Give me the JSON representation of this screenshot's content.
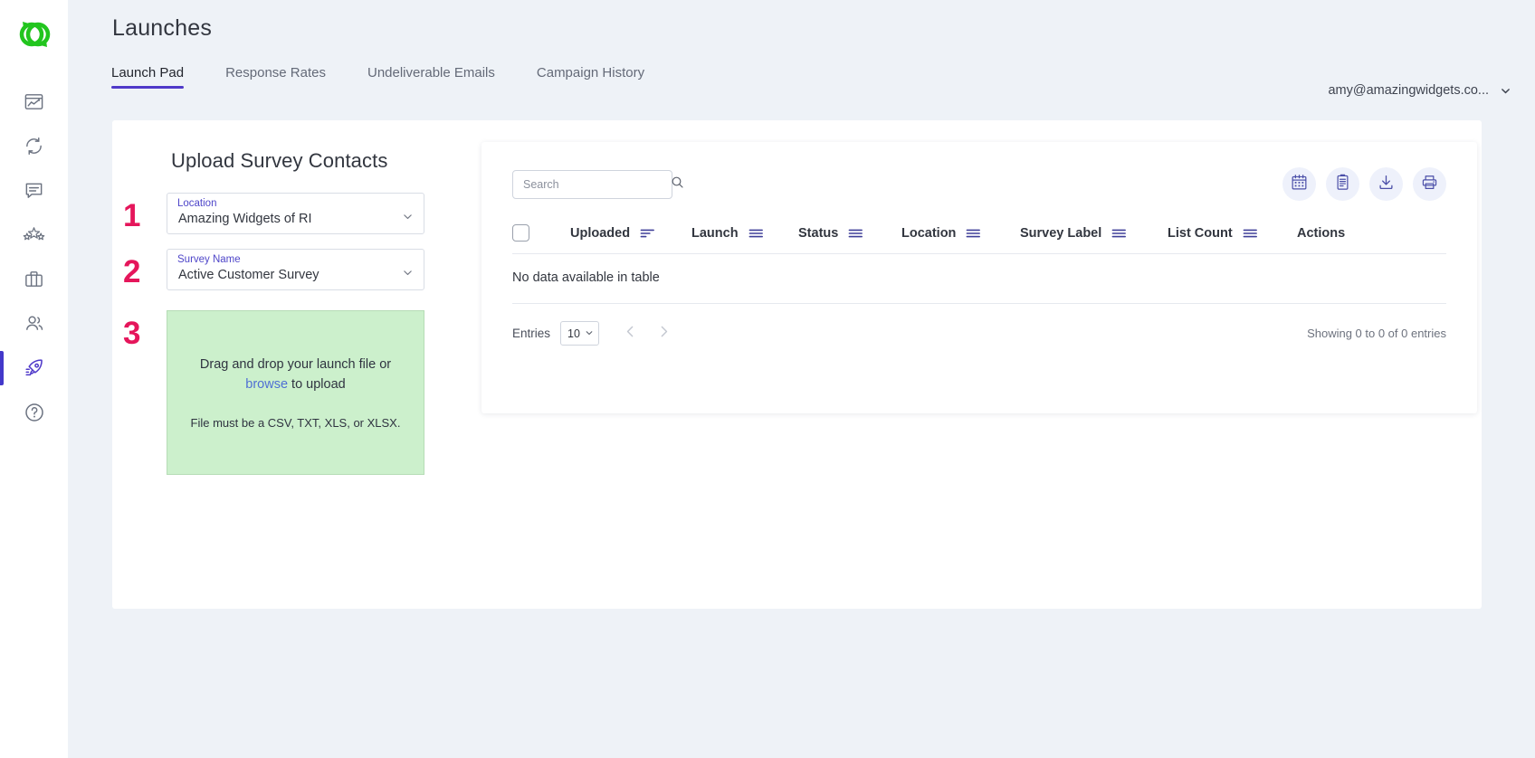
{
  "app": {
    "logo_icon": "green-infinity-links-logo"
  },
  "sidebar": {
    "items": [
      {
        "name": "dashboard-analytics",
        "icon": "dashboard-chart-icon",
        "active": false
      },
      {
        "name": "sync",
        "icon": "refresh-sync-icon",
        "active": false
      },
      {
        "name": "messages",
        "icon": "chat-bubble-icon",
        "active": false
      },
      {
        "name": "reviews",
        "icon": "stars-rating-icon",
        "active": false
      },
      {
        "name": "business",
        "icon": "briefcase-icon",
        "active": false
      },
      {
        "name": "contacts",
        "icon": "people-group-icon",
        "active": false
      },
      {
        "name": "launches",
        "icon": "rocket-icon",
        "active": true
      },
      {
        "name": "help",
        "icon": "question-circle-icon",
        "active": false
      }
    ]
  },
  "header": {
    "title": "Launches",
    "tabs": [
      {
        "label": "Launch Pad",
        "active": true
      },
      {
        "label": "Response Rates",
        "active": false
      },
      {
        "label": "Undeliverable Emails",
        "active": false
      },
      {
        "label": "Campaign History",
        "active": false
      }
    ],
    "user": {
      "email": "amy@amazingwidgets.co...",
      "chevron_icon": "chevron-down-icon"
    }
  },
  "upload": {
    "title": "Upload Survey Contacts",
    "steps": [
      "1",
      "2",
      "3"
    ],
    "location": {
      "label": "Location",
      "value": "Amazing Widgets of RI",
      "chevron_icon": "chevron-down-icon"
    },
    "survey": {
      "label": "Survey Name",
      "value": "Active Customer Survey",
      "chevron_icon": "chevron-down-icon"
    },
    "dropzone": {
      "text_before": "Drag and drop your launch file or",
      "link": "browse",
      "text_after": "to upload",
      "hint": "File must be a CSV, TXT, XLS, or XLSX.",
      "bg_color": "#ccf0cc",
      "link_color": "#4f6fd4"
    }
  },
  "table": {
    "search": {
      "placeholder": "Search",
      "value": "",
      "icon": "search-icon"
    },
    "toolbar": [
      {
        "name": "calendar-button",
        "icon": "calendar-icon"
      },
      {
        "name": "report-button",
        "icon": "clipboard-document-icon"
      },
      {
        "name": "download-button",
        "icon": "download-icon"
      },
      {
        "name": "print-button",
        "icon": "printer-icon"
      }
    ],
    "select_all": {
      "name": "select-all-checkbox",
      "checked": false
    },
    "columns": [
      {
        "label": "Uploaded",
        "sort_icon": "sort-descending-icon",
        "sortable": true
      },
      {
        "label": "Launch",
        "sort_icon": "sort-menu-icon",
        "sortable": true
      },
      {
        "label": "Status",
        "sort_icon": "sort-menu-icon",
        "sortable": true
      },
      {
        "label": "Location",
        "sort_icon": "sort-menu-icon",
        "sortable": true
      },
      {
        "label": "Survey Label",
        "sort_icon": "sort-menu-icon",
        "sortable": true
      },
      {
        "label": "List Count",
        "sort_icon": "sort-menu-icon",
        "sortable": true
      },
      {
        "label": "Actions",
        "sort_icon": "",
        "sortable": false
      }
    ],
    "rows": [],
    "empty_message": "No data available in table",
    "footer": {
      "entries_label": "Entries",
      "entries_value": "10",
      "entries_chevron_icon": "chevron-down-icon",
      "prev_icon": "chevron-left-icon",
      "next_icon": "chevron-right-icon",
      "showing": "Showing 0 to 0 of 0 entries"
    }
  },
  "colors": {
    "accent_purple": "#4f39c9",
    "step_number": "#e5165b",
    "logo_green": "#22c51e",
    "page_bg": "#eef2f7"
  }
}
